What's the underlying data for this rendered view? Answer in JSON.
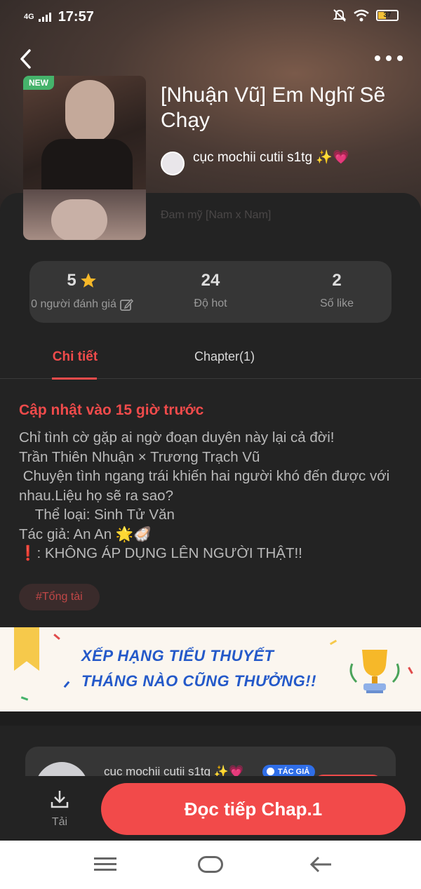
{
  "status_bar": {
    "network": "4G",
    "time": "17:57",
    "battery": "37"
  },
  "book": {
    "badge": "NEW",
    "title": "[Nhuận Vũ] Em Nghĩ Sẽ Chạy",
    "author": "cục mochii cutii s1tg ✨💗",
    "genre": "Đam mỹ [Nam x Nam]"
  },
  "stats": {
    "rating_value": "5",
    "rating_label": "0 người đánh giá",
    "hot_value": "24",
    "hot_label": "Độ hot",
    "like_value": "2",
    "like_label": "Số like"
  },
  "tabs": {
    "detail": "Chi tiết",
    "chapter": "Chapter(1)"
  },
  "detail": {
    "updated": "Cập nhật vào 15 giờ trước",
    "description": "Chỉ tình cờ gặp ai ngờ đoạn duyên này lại cả đời!\nTrần Thiên Nhuận × Trương Trạch Vũ\n Chuyện tình ngang trái khiến hai người khó đến được với nhau.Liệu họ sẽ ra sao?\n    Thể loại: Sinh Tử Văn\nTác giả: An An 🌟🦪\n❗: KHÔNG ÁP DỤNG LÊN NGƯỜI THẬT!!",
    "tag": "#Tổng tài"
  },
  "banner": {
    "line1": "XẾP HẠNG TIỂU THUYẾT",
    "line2": "THÁNG NÀO CŨNG THƯỞNG!!"
  },
  "author_card": {
    "name": "cục mochii cutii s1tg ✨💗",
    "badge": "TÁC GIẢ"
  },
  "bottom_bar": {
    "download_label": "Tải",
    "read_label": "Đọc tiếp Chap.1"
  },
  "colors": {
    "accent": "#f04b4b",
    "background": "#232323",
    "banner_text": "#2459c9"
  }
}
